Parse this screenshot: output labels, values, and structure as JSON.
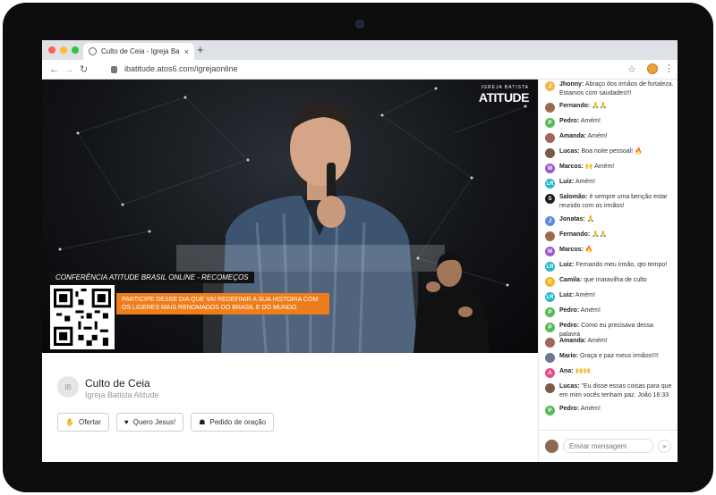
{
  "browser": {
    "tab_title": "Culto de Ceia - Igreja Batista A...",
    "tab_close": "×",
    "new_tab": "+",
    "url": "ibatitude.atos6.com/igrejaonline",
    "controls": {
      "back": "←",
      "forward": "→",
      "reload": "↻",
      "star": "☆",
      "menu": "⋮"
    },
    "traffic_lights": [
      "#ff5f57",
      "#febc2e",
      "#28c840"
    ]
  },
  "video": {
    "brand_small": "IGREJA BATISTA",
    "brand_main": "ATITUDE",
    "lower_third_title": "CONFERÊNCIA ATITUDE BRASIL ONLINE - RECOMEÇOS",
    "lower_third_banner": "PARTICIPE DESSE DIA QUE VAI REDEFINIR A SUA HISTORIA COM OS LIDERES MAIS RENOMADOS DO BRASIL E DO MUNDO"
  },
  "stream": {
    "channel_avatar": "IB",
    "title": "Culto de Ceia",
    "subtitle": "Igreja Batista Atitude",
    "actions": [
      {
        "label": "Ofertar",
        "icon": "hand-money-icon"
      },
      {
        "label": "Quero Jesus!",
        "icon": "heart-icon"
      },
      {
        "label": "Pedido de oração",
        "icon": "praying-hands-icon"
      }
    ]
  },
  "chat": {
    "messages": [
      {
        "name": "Jhonny:",
        "text": "Abraço dos irmãos de fortaleza. Estamos com saudades!!!",
        "initial": "J",
        "color": "#f5b54a"
      },
      {
        "name": "Fernando:",
        "text": "🙏🙏",
        "initial": "",
        "color": "#9c6b4e"
      },
      {
        "name": "Pedro:",
        "text": "Amém!",
        "initial": "P",
        "color": "#5cb85c"
      },
      {
        "name": "Amanda:",
        "text": "Amém!",
        "initial": "",
        "color": "#a0665a"
      },
      {
        "name": "Lucas:",
        "text": "Boa noite pessoal! 🔥",
        "initial": "",
        "color": "#7a5a48"
      },
      {
        "name": "Marcos:",
        "text": "🙌 Amém!",
        "initial": "M",
        "color": "#9b59d0"
      },
      {
        "name": "Luiz:",
        "text": "Amém!",
        "initial": "LR",
        "color": "#26b7c9"
      },
      {
        "name": "Salomão:",
        "text": "é sempre uma benção estar reunido com os irmãos!",
        "initial": "S",
        "color": "#1e1e1e"
      },
      {
        "name": "Jonatas:",
        "text": "🙏",
        "initial": "J",
        "color": "#5b8dd9"
      },
      {
        "name": "Fernando:",
        "text": "🙏🙏",
        "initial": "",
        "color": "#9c6b4e"
      },
      {
        "name": "Marcos:",
        "text": "🔥",
        "initial": "M",
        "color": "#9b59d0"
      },
      {
        "name": "Luiz:",
        "text": "Fernando meu irmão, qto tempo!",
        "initial": "LR",
        "color": "#26b7c9"
      },
      {
        "name": "Camila:",
        "text": "que maravilha de culto",
        "initial": "C",
        "color": "#f0b429"
      },
      {
        "name": "Luiz:",
        "text": "Amém!",
        "initial": "LR",
        "color": "#26b7c9"
      },
      {
        "name": "Pedro:",
        "text": "Amém!",
        "initial": "P",
        "color": "#5cb85c"
      },
      {
        "name": "Pedro:",
        "text": "Como eu precisava dessa palavra",
        "initial": "P",
        "color": "#5cb85c"
      },
      {
        "name": "Amanda:",
        "text": "Amém!",
        "initial": "",
        "color": "#a0665a"
      },
      {
        "name": "Mario:",
        "text": "Graça e paz meus irmãos!!!!",
        "initial": "",
        "color": "#6a7a8c"
      },
      {
        "name": "Ana:",
        "text": "🙌🙌",
        "initial": "A",
        "color": "#e84b8a"
      },
      {
        "name": "Lucas:",
        "text": "\"Eu disse essas coisas para que em mim vocês tenham paz. João 16:33",
        "initial": "",
        "color": "#7a5a48"
      },
      {
        "name": "Pedro:",
        "text": "Amém!",
        "initial": "P",
        "color": "#5cb85c"
      }
    ],
    "input_placeholder": "Enviar mensagem",
    "send": "➤"
  }
}
